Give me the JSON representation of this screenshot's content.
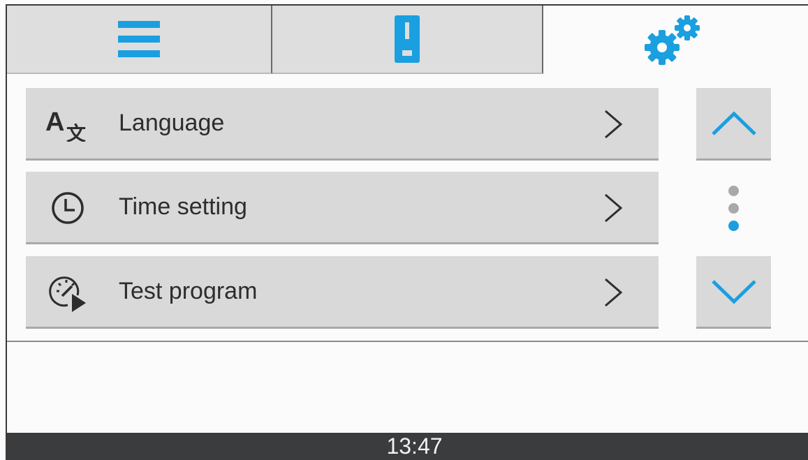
{
  "colors": {
    "accent": "#1a9fe0",
    "tab_inactive": "#dedede",
    "row_bg": "#d9d9d9",
    "text": "#2d2d2d",
    "status_bar": "#3b3c3e",
    "dot_inactive": "#a9a9a9"
  },
  "tabs": [
    {
      "icon": "menu-icon",
      "active": false
    },
    {
      "icon": "device-icon",
      "active": false
    },
    {
      "icon": "gears-icon",
      "active": true
    }
  ],
  "menu": {
    "items": [
      {
        "label": "Language",
        "icon": "language-icon"
      },
      {
        "label": "Time setting",
        "icon": "clock-icon"
      },
      {
        "label": "Test program",
        "icon": "test-program-icon"
      }
    ]
  },
  "scroll": {
    "up_icon": "chevron-up-icon",
    "down_icon": "chevron-down-icon",
    "page_count": 3,
    "current_page": 3
  },
  "status": {
    "time": "13:47"
  }
}
